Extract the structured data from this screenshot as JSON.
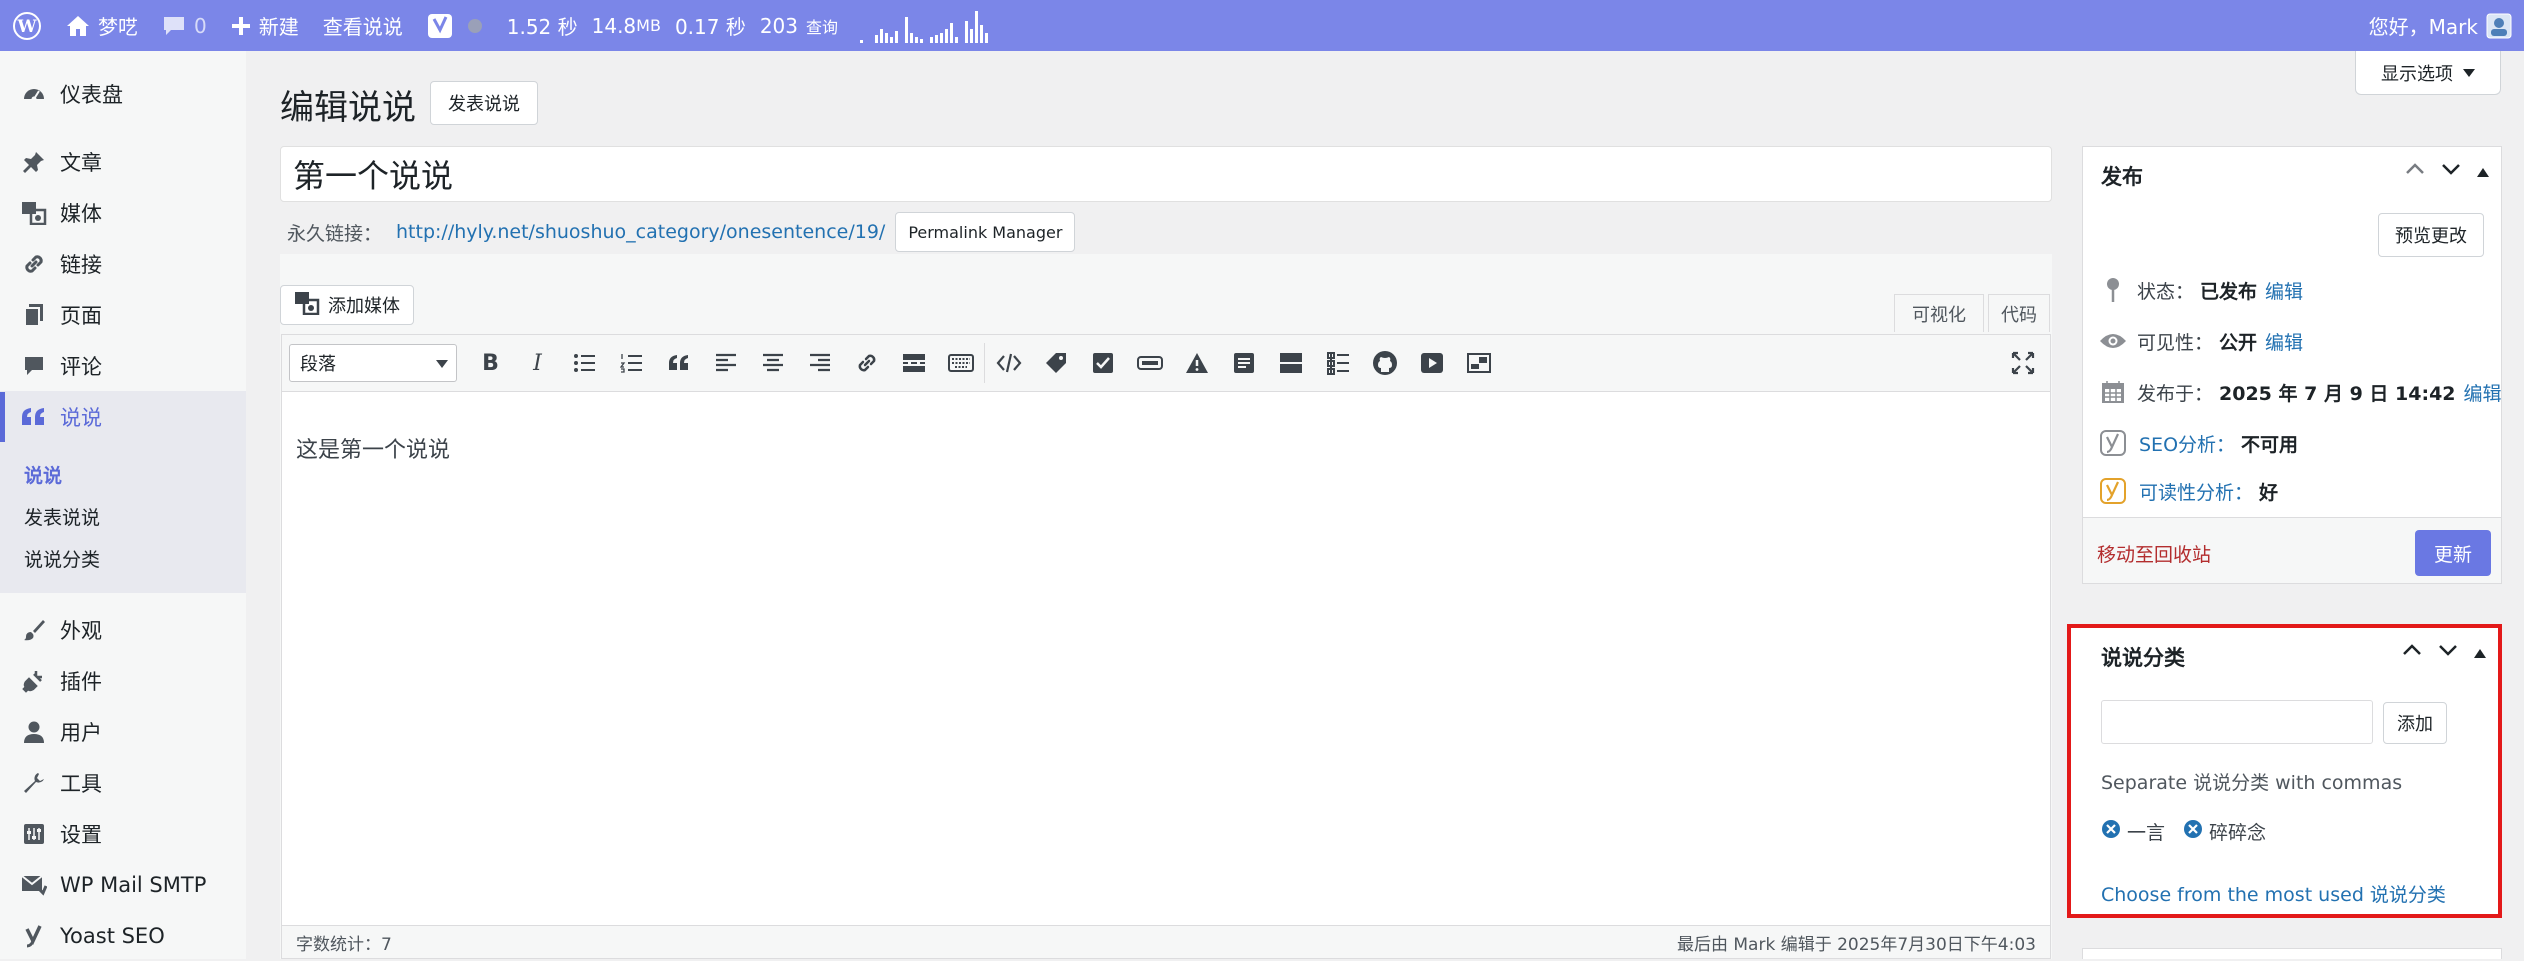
{
  "admin_bar": {
    "site_name": "梦呓",
    "comments_count": "0",
    "new_label": "新建",
    "view_label": "查看说说",
    "query_time": "1.52 秒",
    "memory": "14.8",
    "memory_unit": "MB",
    "db_time": "0.17 秒",
    "queries": "203",
    "queries_label": "查询",
    "greeting": "您好，Mark"
  },
  "sidebar": {
    "items": [
      {
        "label": "仪表盘",
        "icon": "dashboard-icon"
      },
      {
        "label": "文章",
        "icon": "pin-icon"
      },
      {
        "label": "媒体",
        "icon": "media-icon"
      },
      {
        "label": "链接",
        "icon": "link-icon"
      },
      {
        "label": "页面",
        "icon": "page-icon"
      },
      {
        "label": "评论",
        "icon": "comment-icon"
      },
      {
        "label": "说说",
        "icon": "quote-icon"
      },
      {
        "label": "外观",
        "icon": "brush-icon"
      },
      {
        "label": "插件",
        "icon": "plugin-icon"
      },
      {
        "label": "用户",
        "icon": "user-icon"
      },
      {
        "label": "工具",
        "icon": "wrench-icon"
      },
      {
        "label": "设置",
        "icon": "settings-icon"
      },
      {
        "label": "WP Mail SMTP",
        "icon": "mail-icon"
      },
      {
        "label": "Yoast SEO",
        "icon": "yoast-icon"
      }
    ],
    "submenu": [
      "说说",
      "发表说说",
      "说说分类"
    ]
  },
  "header": {
    "page_title": "编辑说说",
    "add_new_label": "发表说说",
    "screen_options_label": "显示选项"
  },
  "post": {
    "title": "第一个说说",
    "permalink_label": "永久链接：",
    "permalink_url": "http://hyly.net/shuoshuo_category/onesentence/19/",
    "permalink_manager_label": "Permalink Manager",
    "content": "这是第一个说说"
  },
  "editor": {
    "add_media_label": "添加媒体",
    "tab_visual": "可视化",
    "tab_code": "代码",
    "format_value": "段落",
    "word_count": "字数统计：7",
    "last_edited": "最后由 Mark 编辑于 2025年7月30日下午4:03"
  },
  "publish_box": {
    "title": "发布",
    "preview_label": "预览更改",
    "status_label": "状态：",
    "status_value": "已发布",
    "visibility_label": "可见性：",
    "visibility_value": "公开",
    "published_label": "发布于：",
    "published_value": "2025 年 7 月 9 日 14:42",
    "edit_label": "编辑",
    "seo_label": "SEO分析：",
    "seo_value": "不可用",
    "readability_label": "可读性分析：",
    "readability_value": "好",
    "trash_label": "移动至回收站",
    "update_label": "更新"
  },
  "category_box": {
    "title": "说说分类",
    "add_label": "添加",
    "howto": "Separate 说说分类 with commas",
    "tags": [
      "一言",
      "碎碎念"
    ],
    "most_used": "Choose from the most used 说说分类"
  },
  "colors": {
    "admin_bar": "#7b86e8",
    "accent": "#5b6ad8",
    "update_button": "#6a78e3",
    "highlight_border": "#e31919",
    "trash_link": "#b32d2e",
    "readability_good": "#e3a22b"
  }
}
